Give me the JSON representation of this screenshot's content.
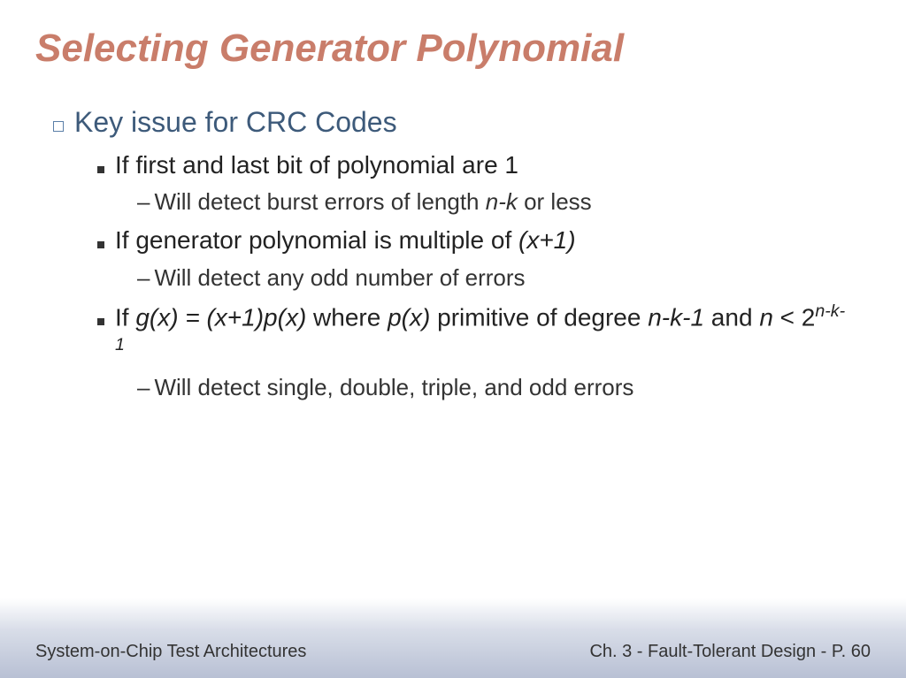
{
  "title": "Selecting Generator Polynomial",
  "level1_text": "Key issue for CRC Codes",
  "items": [
    {
      "text_parts": [
        "If first and last bit of polynomial are 1"
      ],
      "sub": [
        {
          "text_parts": [
            "Will detect burst errors of length ",
            "n-k",
            " or less"
          ]
        }
      ]
    },
    {
      "text_parts": [
        "If generator polynomial is multiple of ",
        "(x+1)"
      ],
      "sub": [
        {
          "text_parts": [
            "Will detect any odd number of errors"
          ]
        }
      ]
    },
    {
      "text_parts": [
        "If ",
        "g(x) = (x+1)p(x)",
        " where ",
        "p(x)",
        " primitive of degree ",
        "n-k-1",
        " and ",
        "n",
        " < 2",
        "n-k-1"
      ],
      "sub": [
        {
          "text_parts": [
            "Will detect single, double, triple, and odd errors"
          ]
        }
      ]
    }
  ],
  "footer_left": "System-on-Chip Test Architectures",
  "footer_right_prefix": "Ch. 3 - Fault-Tolerant Design - P. ",
  "page_num": "60",
  "page_num_small": "60"
}
